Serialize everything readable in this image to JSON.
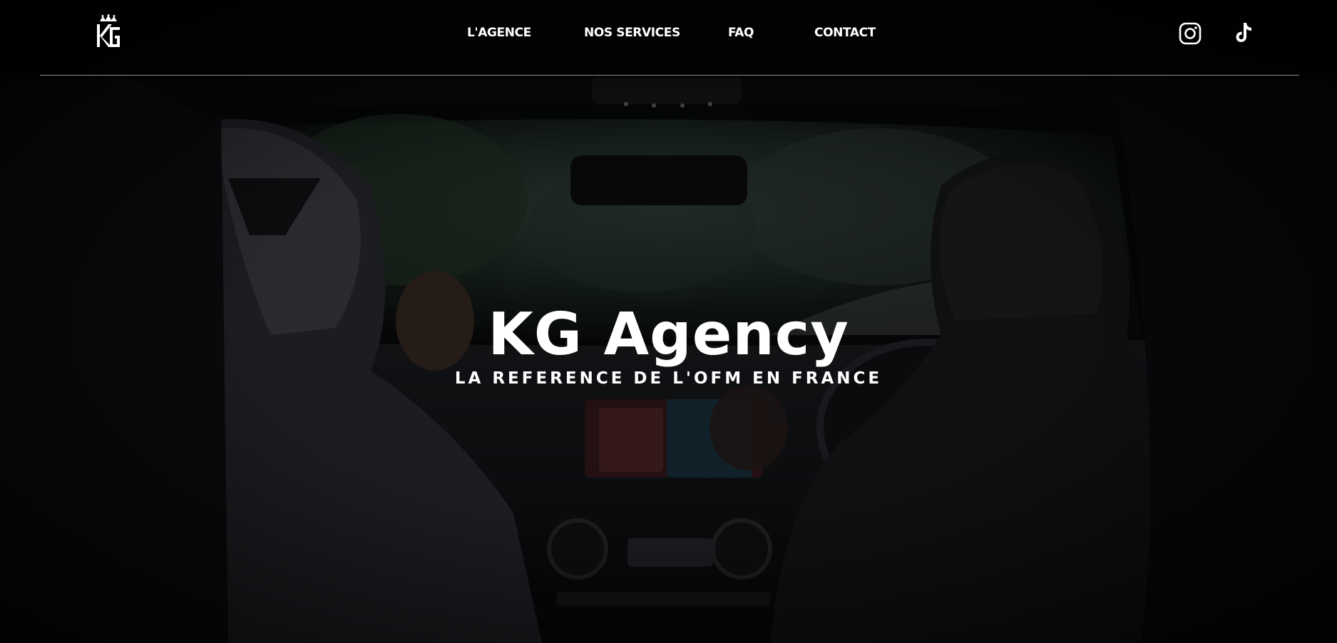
{
  "brand": {
    "logo_icon": "kg-crown-logo-icon"
  },
  "nav": {
    "items": [
      {
        "label": "L'AGENCE"
      },
      {
        "label": "NOS SERVICES"
      },
      {
        "label": "FAQ"
      },
      {
        "label": "CONTACT"
      }
    ]
  },
  "social": {
    "instagram_icon": "instagram-icon",
    "tiktok_icon": "tiktok-icon"
  },
  "hero": {
    "title": "KG Agency",
    "subtitle": "LA REFERENCE DE L'OFM EN FRANCE"
  },
  "colors": {
    "background": "#050506",
    "text": "#ffffff",
    "divider": "#8a8a8e"
  }
}
